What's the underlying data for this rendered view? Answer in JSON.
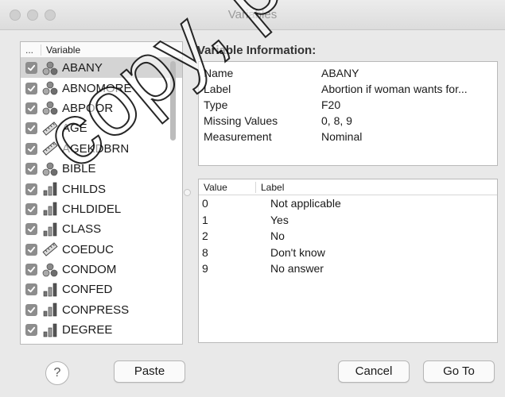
{
  "window": {
    "title": "Variables"
  },
  "variable_list": {
    "header_dots": "...",
    "header_label": "Variable",
    "items": [
      {
        "name": "ABANY",
        "type": "nominal",
        "checked": true,
        "selected": true
      },
      {
        "name": "ABNOMORE",
        "type": "nominal",
        "checked": true
      },
      {
        "name": "ABPOOR",
        "type": "nominal",
        "checked": true
      },
      {
        "name": "AGE",
        "type": "scale",
        "checked": true
      },
      {
        "name": "AGEKDBRN",
        "type": "scale",
        "checked": true
      },
      {
        "name": "BIBLE",
        "type": "nominal",
        "checked": true
      },
      {
        "name": "CHILDS",
        "type": "ordinal",
        "checked": true
      },
      {
        "name": "CHLDIDEL",
        "type": "ordinal",
        "checked": true
      },
      {
        "name": "CLASS",
        "type": "ordinal",
        "checked": true
      },
      {
        "name": "COEDUC",
        "type": "scale",
        "checked": true
      },
      {
        "name": "CONDOM",
        "type": "nominal",
        "checked": true
      },
      {
        "name": "CONFED",
        "type": "ordinal",
        "checked": true
      },
      {
        "name": "CONPRESS",
        "type": "ordinal",
        "checked": true
      },
      {
        "name": "DEGREE",
        "type": "ordinal",
        "checked": true
      }
    ]
  },
  "variable_info": {
    "title": "Variable Information:",
    "rows": [
      {
        "key": "Name",
        "value": "ABANY"
      },
      {
        "key": "Label",
        "value": "Abortion if woman wants for..."
      },
      {
        "key": "Type",
        "value": "F20"
      },
      {
        "key": "Missing Values",
        "value": "0, 8, 9"
      },
      {
        "key": "Measurement",
        "value": "Nominal"
      }
    ]
  },
  "value_labels": {
    "header_value": "Value",
    "header_label": "Label",
    "rows": [
      {
        "value": "0",
        "label": "Not applicable"
      },
      {
        "value": "1",
        "label": "Yes"
      },
      {
        "value": "2",
        "label": "No"
      },
      {
        "value": "8",
        "label": "Don't know"
      },
      {
        "value": "9",
        "label": "No answer"
      }
    ]
  },
  "buttons": {
    "help": "?",
    "paste": "Paste",
    "cancel": "Cancel",
    "goto": "Go To"
  },
  "watermark": "copy, post, or",
  "icons": {
    "nominal": "nominal-icon",
    "scale": "scale-ruler-icon",
    "ordinal": "ordinal-bars-icon",
    "check": "checkmark-icon"
  }
}
